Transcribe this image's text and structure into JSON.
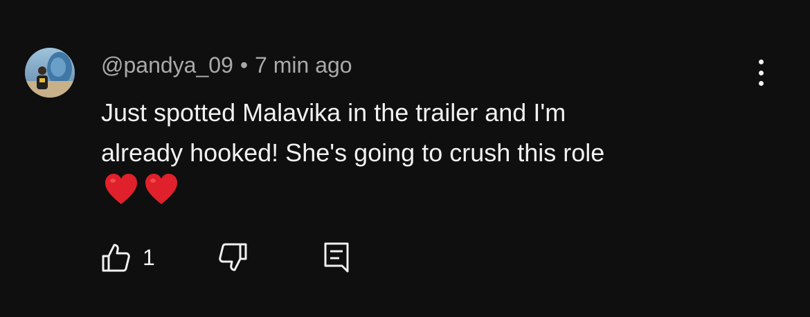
{
  "comment": {
    "username": "@pandya_09",
    "separator": "•",
    "time": "7 min ago",
    "lines": [
      "Just spotted Malavika in the trailer and I'm",
      "already hooked! She's going to crush this role"
    ],
    "emojis": [
      "heart-emoji",
      "heart-emoji"
    ]
  },
  "actions": {
    "like_icon": "thumbs-up-icon",
    "like_count": "1",
    "dislike_icon": "thumbs-down-icon",
    "reply_icon": "reply-comment-icon"
  },
  "menu": {
    "icon": "more-vertical-icon"
  },
  "colors": {
    "background": "#0f0f0f",
    "text_primary": "#f1f1f1",
    "text_secondary": "#aaaaaa",
    "heart": "#e0202a"
  }
}
